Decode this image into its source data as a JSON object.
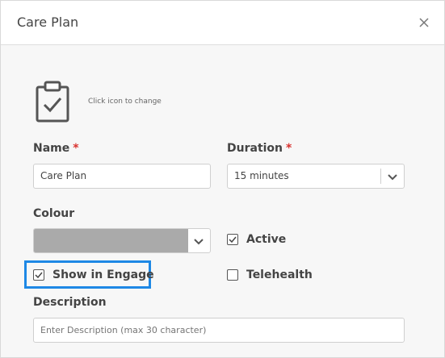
{
  "dialog": {
    "title": "Care Plan",
    "close_icon": "close-icon"
  },
  "icon_picker": {
    "icon": "clipboard-check-icon",
    "hint": "Click icon to change"
  },
  "form": {
    "name": {
      "label": "Name",
      "required": "*",
      "value": "Care Plan"
    },
    "duration": {
      "label": "Duration",
      "required": "*",
      "value": "15 minutes"
    },
    "colour": {
      "label": "Colour",
      "value_color": "#aaaaaa"
    },
    "active": {
      "label": "Active",
      "checked": true
    },
    "show_in_engage": {
      "label": "Show in Engage",
      "checked": true
    },
    "telehealth": {
      "label": "Telehealth",
      "checked": false
    },
    "description": {
      "label": "Description",
      "placeholder": "Enter Description (max 30 character)",
      "value": ""
    }
  },
  "colors": {
    "required": "#d9322f",
    "highlight": "#1e88e5"
  }
}
